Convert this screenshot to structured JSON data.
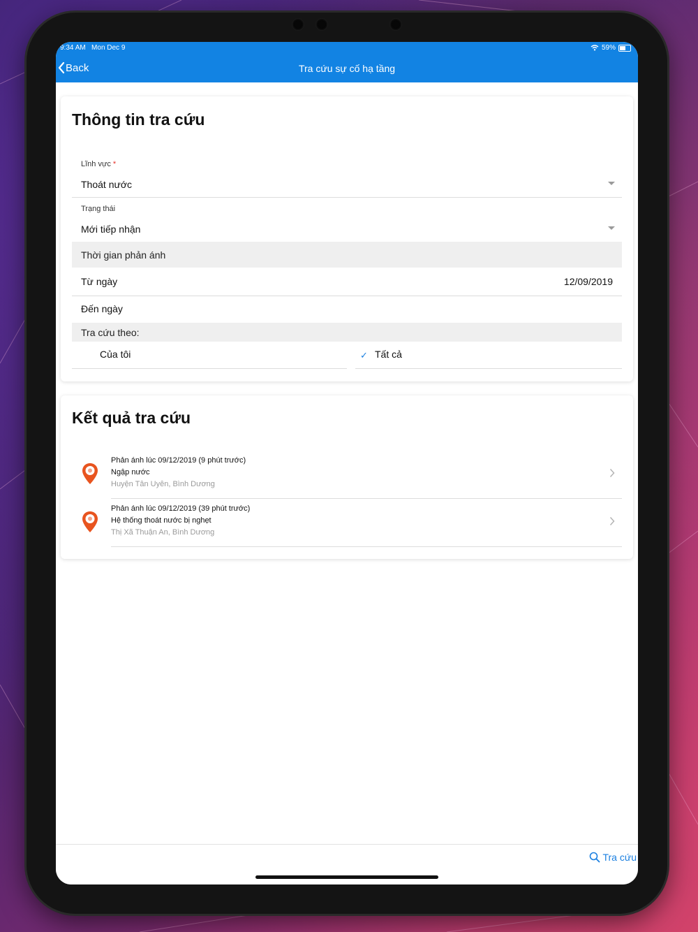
{
  "status": {
    "time": "9:34 AM",
    "date": "Mon Dec 9",
    "battery": "59%"
  },
  "nav": {
    "back_label": "Back",
    "title": "Tra cứu sự cố hạ tầng"
  },
  "search_info": {
    "title": "Thông tin tra cứu",
    "field_label": "Lĩnh vực",
    "field_required_mark": "*",
    "field_value": "Thoát nước",
    "status_label": "Trạng thái",
    "status_value": "Mới tiếp nhận",
    "time_section": "Thời gian phản ánh",
    "from_label": "Từ ngày",
    "from_value": "12/09/2019",
    "to_label": "Đến ngày",
    "to_value": "",
    "lookup_by_section": "Tra cứu theo:",
    "options": [
      {
        "label": "Của tôi",
        "selected": false
      },
      {
        "label": "Tất cả",
        "selected": true
      }
    ],
    "check_glyph": "✓"
  },
  "results": {
    "title": "Kết quả tra cứu",
    "items": [
      {
        "time": "Phản ánh lúc 09/12/2019 (9 phút trước)",
        "title": "Ngập nước",
        "place": "Huyện Tân Uyên, Bình Dương"
      },
      {
        "time": "Phản ánh lúc 09/12/2019 (39 phút trước)",
        "title": "Hệ thống thoát nước bị nghẹt",
        "place": "Thị Xã Thuận An, Bình Dương"
      }
    ]
  },
  "bottom": {
    "search_label": "Tra cứu"
  },
  "colors": {
    "accent": "#1283e3",
    "pin": "#e8541f",
    "check": "#1a7fe0"
  }
}
